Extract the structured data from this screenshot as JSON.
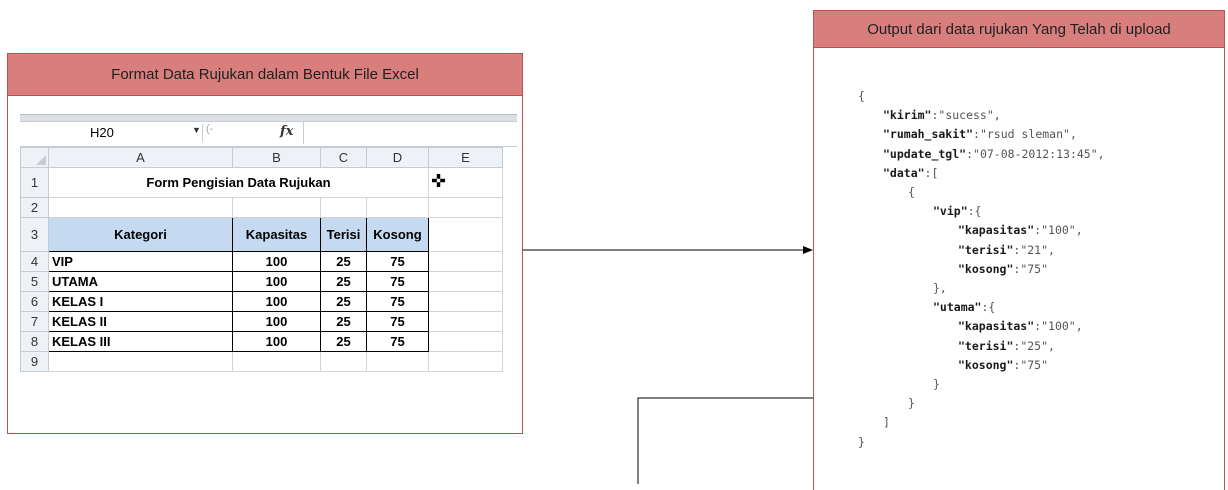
{
  "left_panel": {
    "title": "Format Data Rujukan dalam Bentuk File Excel"
  },
  "excel": {
    "namebox": "H20",
    "fx_label": "fx",
    "columns": [
      "A",
      "B",
      "C",
      "D",
      "E"
    ],
    "row_numbers": [
      "1",
      "2",
      "3",
      "4",
      "5",
      "6",
      "7",
      "8",
      "9"
    ],
    "form_title": "Form Pengisian Data Rujukan",
    "headers": [
      "Kategori",
      "Kapasitas",
      "Terisi",
      "Kosong"
    ],
    "rows": [
      {
        "kategori": "VIP",
        "kapasitas": "100",
        "terisi": "25",
        "kosong": "75"
      },
      {
        "kategori": "UTAMA",
        "kapasitas": "100",
        "terisi": "25",
        "kosong": "75"
      },
      {
        "kategori": "KELAS I",
        "kapasitas": "100",
        "terisi": "25",
        "kosong": "75"
      },
      {
        "kategori": "KELAS II",
        "kapasitas": "100",
        "terisi": "25",
        "kosong": "75"
      },
      {
        "kategori": "KELAS III",
        "kapasitas": "100",
        "terisi": "25",
        "kosong": "75"
      }
    ]
  },
  "right_panel": {
    "title": "Output dari data rujukan Yang Telah di upload",
    "json_lines": [
      {
        "indent": 0,
        "parts": [
          [
            "p",
            "{"
          ]
        ]
      },
      {
        "indent": 1,
        "parts": [
          [
            "k",
            "\"kirim\""
          ],
          [
            "p",
            ":\"sucess\","
          ]
        ]
      },
      {
        "indent": 1,
        "parts": [
          [
            "k",
            "\"rumah_sakit\""
          ],
          [
            "p",
            ":\"rsud sleman\","
          ]
        ]
      },
      {
        "indent": 1,
        "parts": [
          [
            "k",
            "\"update_tgl\""
          ],
          [
            "p",
            ":\"07-08-2012:13:45\","
          ]
        ]
      },
      {
        "indent": 1,
        "parts": [
          [
            "k",
            "\"data\""
          ],
          [
            "p",
            ":["
          ]
        ]
      },
      {
        "indent": 2,
        "parts": [
          [
            "p",
            "{"
          ]
        ]
      },
      {
        "indent": 3,
        "parts": [
          [
            "k",
            "\"vip\""
          ],
          [
            "p",
            ":{"
          ]
        ]
      },
      {
        "indent": 4,
        "parts": [
          [
            "k",
            "\"kapasitas\""
          ],
          [
            "p",
            ":\"100\","
          ]
        ]
      },
      {
        "indent": 4,
        "parts": [
          [
            "k",
            "\"terisi\""
          ],
          [
            "p",
            ":\"21\","
          ]
        ]
      },
      {
        "indent": 4,
        "parts": [
          [
            "k",
            "\"kosong\""
          ],
          [
            "p",
            ":\"75\""
          ]
        ]
      },
      {
        "indent": 3,
        "parts": [
          [
            "p",
            "},"
          ]
        ]
      },
      {
        "indent": 3,
        "parts": [
          [
            "k",
            "\"utama\""
          ],
          [
            "p",
            ":{"
          ]
        ]
      },
      {
        "indent": 4,
        "parts": [
          [
            "k",
            "\"kapasitas\""
          ],
          [
            "p",
            ":\"100\","
          ]
        ]
      },
      {
        "indent": 4,
        "parts": [
          [
            "k",
            "\"terisi\""
          ],
          [
            "p",
            ":\"25\","
          ]
        ]
      },
      {
        "indent": 4,
        "parts": [
          [
            "k",
            "\"kosong\""
          ],
          [
            "p",
            ":\"75\""
          ]
        ]
      },
      {
        "indent": 3,
        "parts": [
          [
            "p",
            "}"
          ]
        ]
      },
      {
        "indent": 2,
        "parts": [
          [
            "p",
            "}"
          ]
        ]
      },
      {
        "indent": 1,
        "parts": [
          [
            "p",
            "]"
          ]
        ]
      },
      {
        "indent": 0,
        "parts": [
          [
            "p",
            "}"
          ]
        ]
      }
    ]
  },
  "colors": {
    "panel_header_bg": "#d87f7d",
    "panel_border": "#c0504d",
    "table_header_bg": "#c5d9f1"
  },
  "icons": {
    "cursor": "plus-cursor-icon",
    "fx": "function-icon",
    "dropdown": "chevron-down-icon"
  }
}
